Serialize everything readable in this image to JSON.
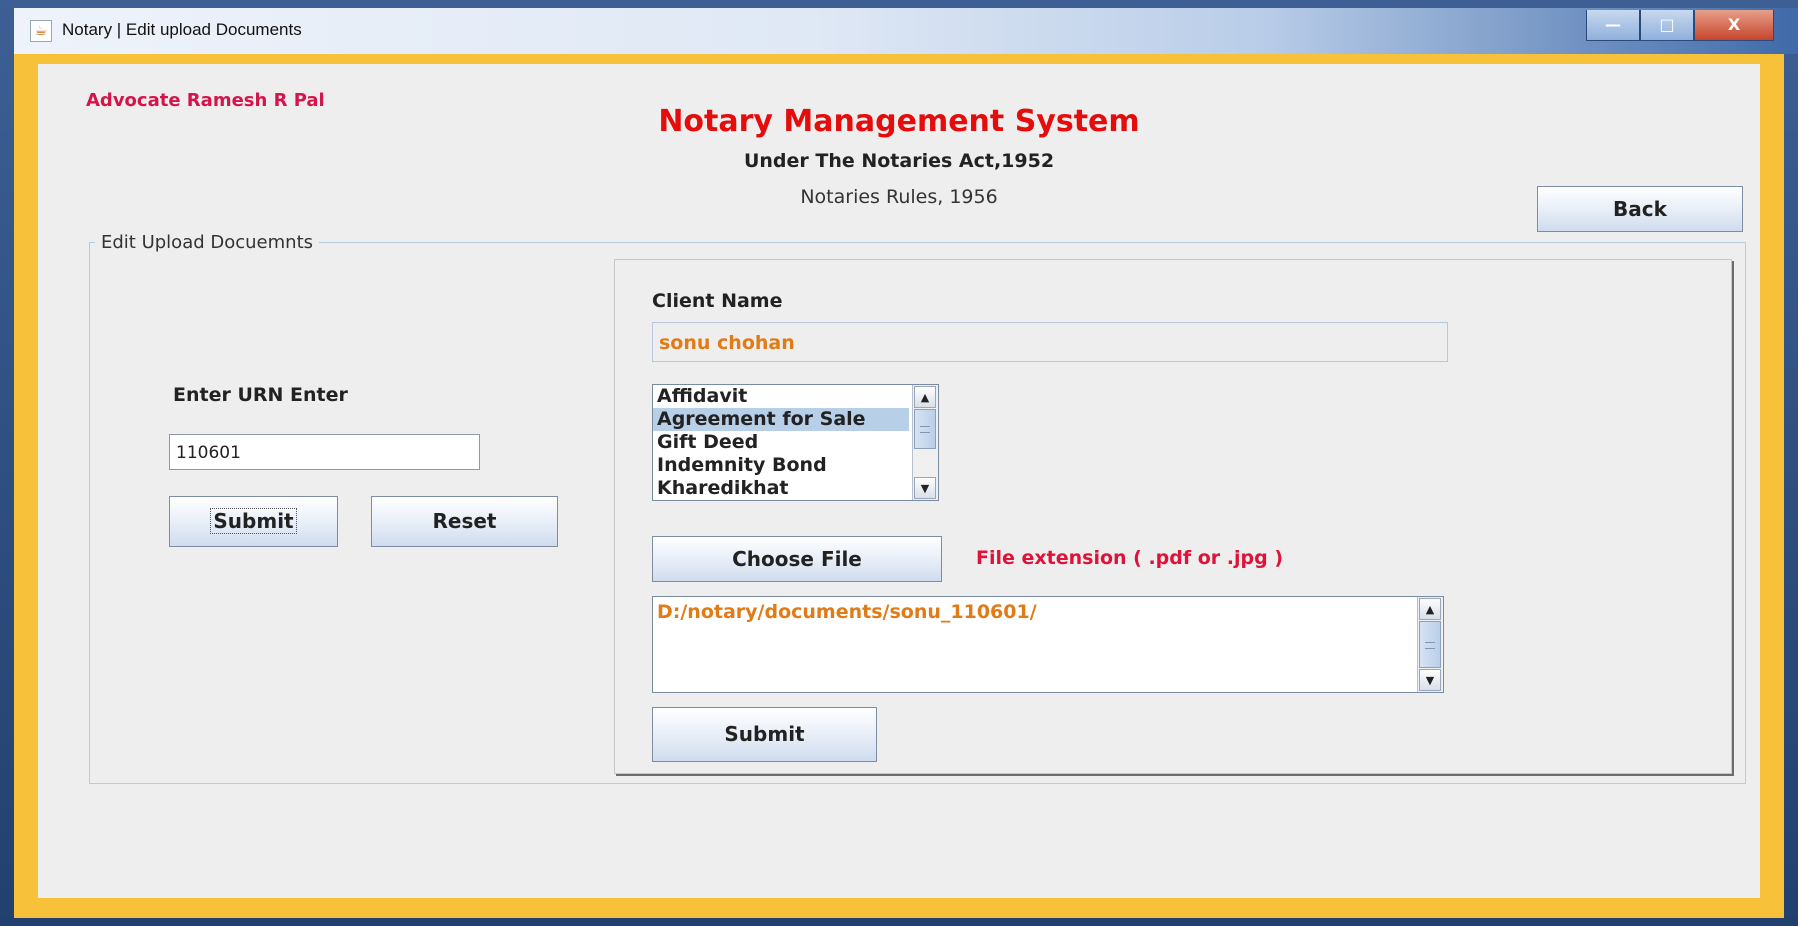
{
  "window": {
    "title": "Notary | Edit upload Documents",
    "controls": {
      "minimize": "—",
      "maximize": "□",
      "close": "X"
    }
  },
  "header": {
    "advocate": "Advocate Ramesh R Pal",
    "app_title": "Notary Management System",
    "subtitle_1": "Under The Notaries Act,1952",
    "subtitle_2": "Notaries Rules, 1956",
    "back_label": "Back"
  },
  "form": {
    "group_title": "Edit Upload Docuemnts",
    "urn_label": "Enter URN Enter",
    "urn_value": "110601",
    "submit_label": "Submit",
    "reset_label": "Reset"
  },
  "panel": {
    "client_label": "Client Name",
    "client_value": "sonu chohan",
    "document_types": [
      "Affidavit",
      "Agreement for Sale",
      "Gift Deed",
      "Indemnity Bond",
      "Kharedikhat"
    ],
    "selected_document": "Agreement for Sale",
    "choose_file_label": "Choose File",
    "extension_note": "File extension ( .pdf or .jpg )",
    "file_path": "D:/notary/documents/sonu_110601/",
    "submit_label": "Submit"
  },
  "colors": {
    "frame": "#f7c23a",
    "title_red": "#e50c0c",
    "advocate": "#d4154a",
    "value_orange": "#e07b16",
    "note_red": "#e0123a",
    "list_selection": "#b8cfe8"
  }
}
